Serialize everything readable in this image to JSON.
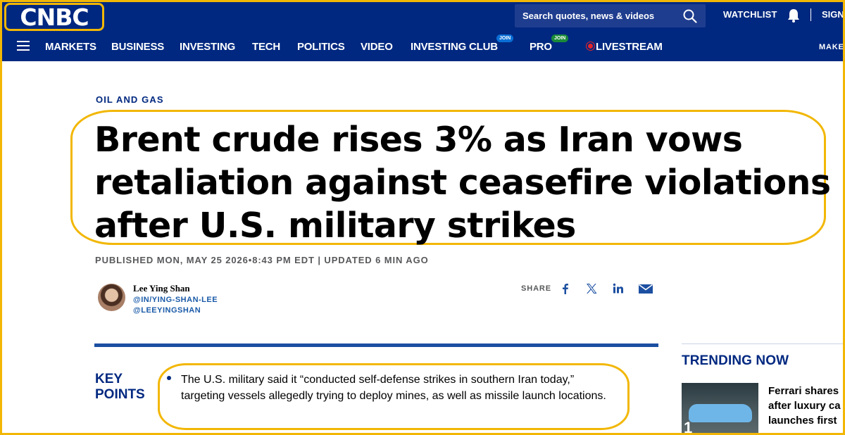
{
  "header": {
    "logo": "CNBC",
    "search_placeholder": "Search quotes, news & videos",
    "watchlist_label": "WATCHLIST",
    "signin_label": "SIGN"
  },
  "nav": {
    "items": [
      {
        "label": "MARKETS"
      },
      {
        "label": "BUSINESS"
      },
      {
        "label": "INVESTING"
      },
      {
        "label": "TECH"
      },
      {
        "label": "POLITICS"
      },
      {
        "label": "VIDEO"
      },
      {
        "label": "INVESTING CLUB",
        "badge": "JOIN"
      },
      {
        "label": "PRO",
        "badge": "JOIN"
      },
      {
        "label": "LIVESTREAM"
      }
    ],
    "overflow_label": "MAKE",
    "badge_colors": {
      "investing_club": "#0b6fd6",
      "pro": "#1a8a3a"
    }
  },
  "article": {
    "section": "OIL AND GAS",
    "headline": "Brent crude rises 3% as Iran vows retaliation against ceasefire violations after U.S. military strikes",
    "published": "PUBLISHED MON, MAY 25 2026•8:43 PM EDT | UPDATED 6 MIN AGO",
    "author": {
      "name": "Lee Ying Shan",
      "handles": [
        "@IN/YING-SHAN-LEE",
        "@LEEYINGSHAN"
      ]
    },
    "share_label": "SHARE",
    "share_icons": [
      "facebook-icon",
      "x-icon",
      "linkedin-icon",
      "email-icon"
    ],
    "key_points_label": "KEY POINTS",
    "key_points": [
      "The U.S. military said it “conducted self-defense strikes in southern Iran today,” targeting vessels allegedly trying to deploy mines, as well as missile launch locations."
    ]
  },
  "trending": {
    "title": "TRENDING NOW",
    "items": [
      {
        "rank": "1",
        "lines": [
          "Ferrari shares",
          "after luxury ca",
          "launches first"
        ]
      }
    ]
  },
  "colors": {
    "brand_navy": "#002880",
    "highlight": "#f2b705",
    "accent_blue": "#1c4fa1",
    "live_red": "#e8232a"
  }
}
